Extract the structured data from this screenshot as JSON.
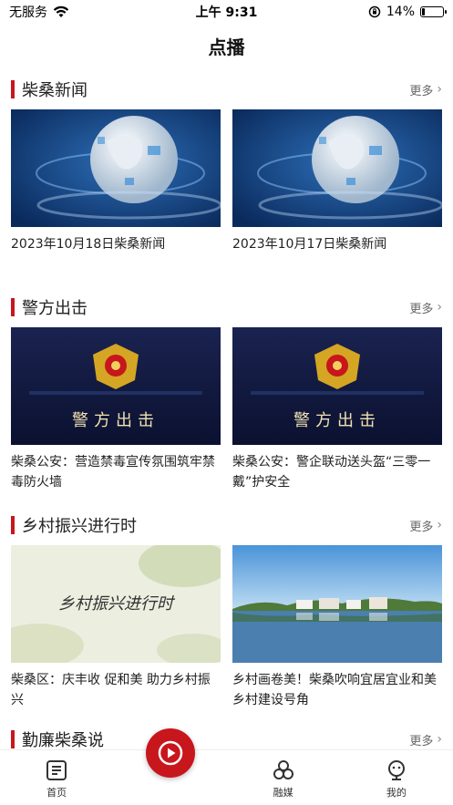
{
  "status_bar": {
    "carrier": "无服务",
    "time": "上午 9:31",
    "battery_text": "14%",
    "battery_level": 0.14
  },
  "page": {
    "title": "点播"
  },
  "sections": [
    {
      "title": "柴桑新闻",
      "more": "更多",
      "items": [
        {
          "title": "2023年10月18日柴桑新闻",
          "thumb": "globe-news"
        },
        {
          "title": "2023年10月17日柴桑新闻",
          "thumb": "globe-news"
        }
      ]
    },
    {
      "title": "警方出击",
      "more": "更多",
      "items": [
        {
          "title": "柴桑公安：营造禁毒宣传氛围筑牢禁毒防火墙",
          "thumb": "police-badge",
          "overlay": "警方出击"
        },
        {
          "title": "柴桑公安：警企联动送头盔“三零一戴”护安全",
          "thumb": "police-badge",
          "overlay": "警方出击"
        }
      ]
    },
    {
      "title": "乡村振兴进行时",
      "more": "更多",
      "items": [
        {
          "title": "柴桑区：庆丰收 促和美 助力乡村振兴",
          "thumb": "calligraphy",
          "overlay": "乡村振兴进行时"
        },
        {
          "title": "乡村画卷美！柴桑吹响宜居宜业和美乡村建设号角",
          "thumb": "village-lake"
        }
      ]
    },
    {
      "title": "勤廉柴桑说",
      "more": "更多",
      "items": []
    }
  ],
  "tabbar": {
    "items": [
      {
        "label": "首页",
        "icon": "news-icon"
      },
      {
        "label": "",
        "icon": "play-icon"
      },
      {
        "label": "融媒",
        "icon": "media-icon"
      },
      {
        "label": "我的",
        "icon": "profile-icon"
      }
    ]
  },
  "colors": {
    "accent": "#c8161d"
  }
}
